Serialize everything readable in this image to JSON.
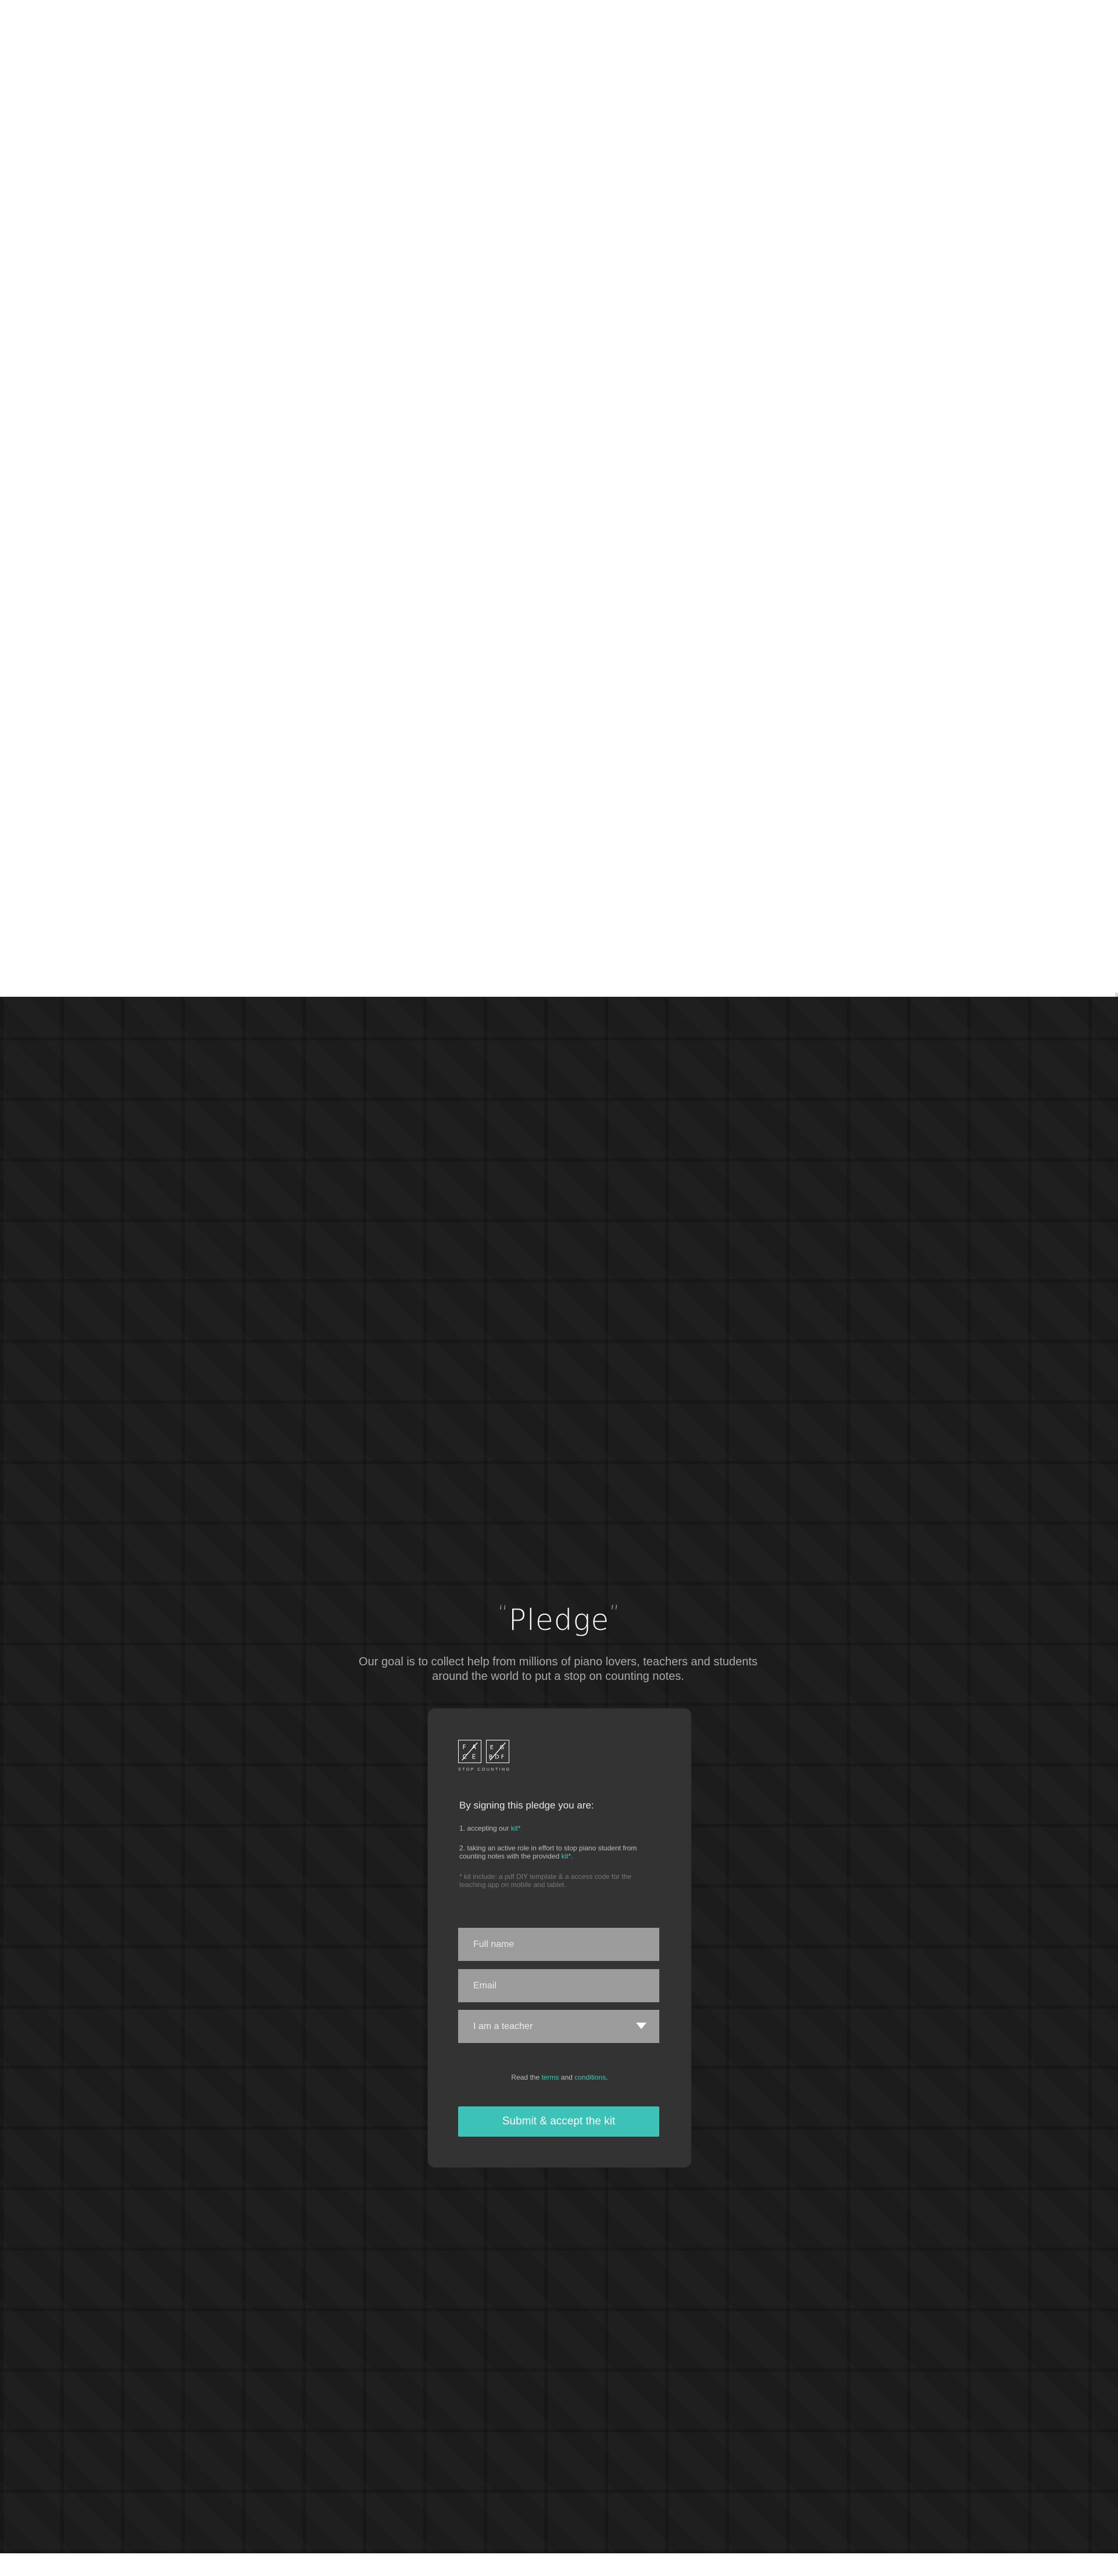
{
  "pledge": {
    "open_quote": "“",
    "title": "Pledge",
    "close_quote": "”",
    "subtitle_line1": "Our goal is to collect help from millions of piano lovers, teachers and students",
    "subtitle_line2": "around the world to put a stop on counting notes."
  },
  "logo": {
    "box1_letters": [
      "F",
      "A",
      "C",
      "E"
    ],
    "box2_letters": [
      "E",
      "G",
      "B",
      "D",
      "F"
    ],
    "caption": "STOP COUNTING"
  },
  "card": {
    "heading": "By signing this pledge you are:",
    "item1_prefix": "1. accepting our ",
    "item1_link": "kit",
    "item1_suffix": "*",
    "item2_text": "2. taking an active role in effort to stop piano student from counting notes with the provided ",
    "item2_link": "kit",
    "item2_suffix": "*.",
    "kit_note": "* kit include: a pdf DIY template & a access code for the teaching app on mobile and tablet."
  },
  "form": {
    "name_placeholder": "Full name",
    "email_placeholder": "Email",
    "role_selected": "I am a teacher"
  },
  "terms": {
    "prefix": "Read the ",
    "terms_link": "terms",
    "middle": " and ",
    "conditions_link": "conditions",
    "suffix": "."
  },
  "submit": {
    "label": "Submit & accept the kit"
  },
  "colors": {
    "accent": "#3cc8b9",
    "background_dark": "#1c1c1c",
    "card": "#333333",
    "field": "#9c9c9c"
  }
}
